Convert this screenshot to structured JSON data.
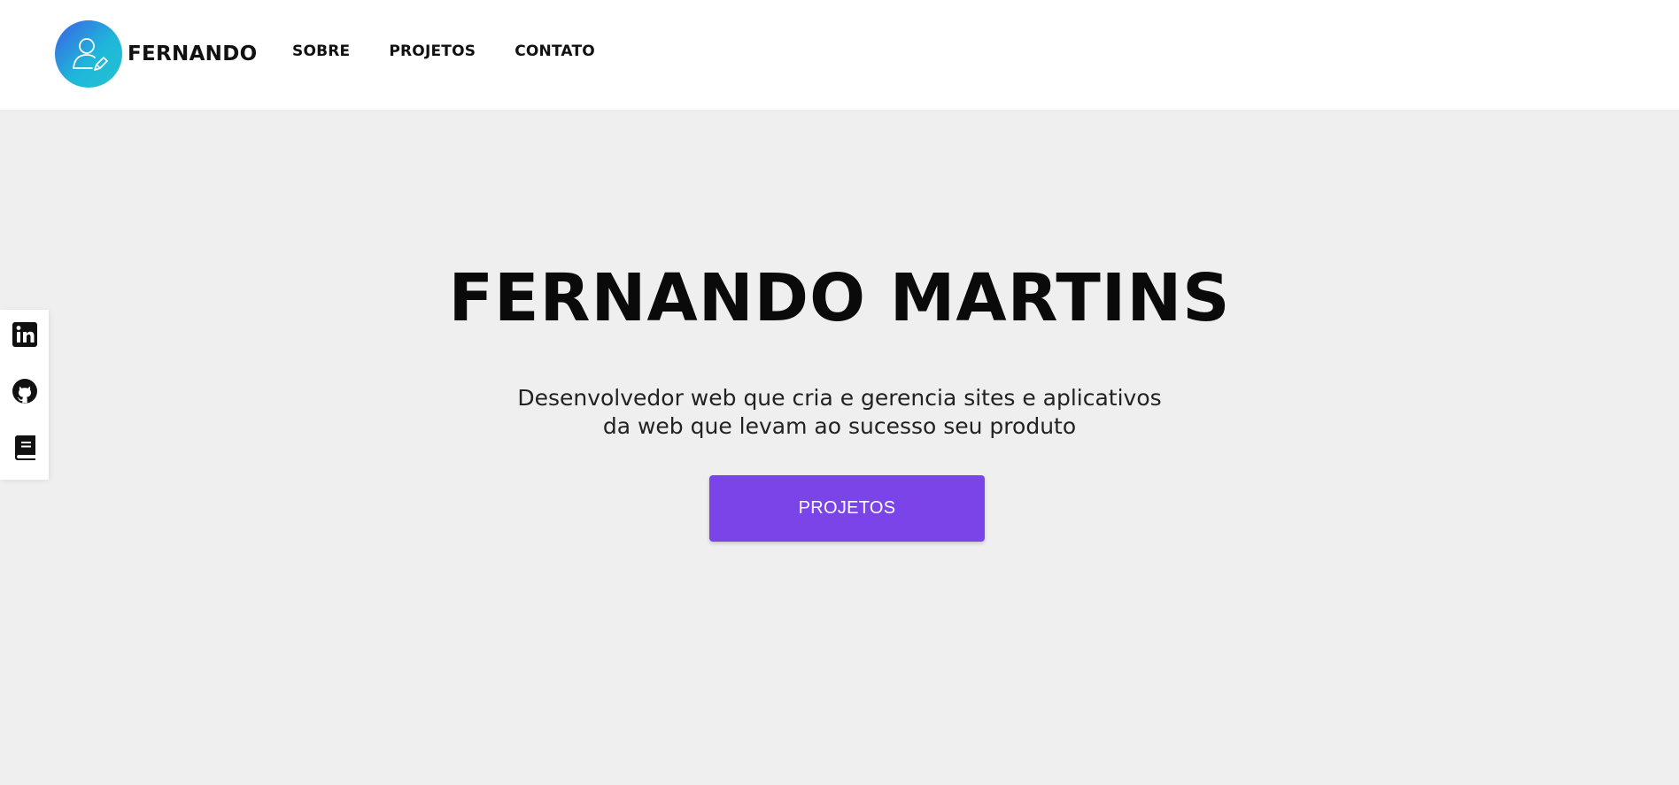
{
  "header": {
    "brand_name": "FERNANDO",
    "nav": [
      {
        "label": "SOBRE"
      },
      {
        "label": "PROJETOS"
      },
      {
        "label": "CONTATO"
      }
    ]
  },
  "social": [
    {
      "icon": "linkedin-icon"
    },
    {
      "icon": "github-icon"
    },
    {
      "icon": "book-icon"
    }
  ],
  "hero": {
    "title": "FERNANDO MARTINS",
    "subtitle_line1": "Desenvolvedor web que cria e gerencia sites e aplicativos",
    "subtitle_line2": "da web que levam ao sucesso seu produto",
    "cta_label": "PROJETOS"
  },
  "colors": {
    "page_background": "#efefef",
    "header_background": "#ffffff",
    "cta_background": "#7b44e8",
    "logo_gradient_start": "#3b5fe6",
    "logo_gradient_end": "#22c3d4"
  }
}
